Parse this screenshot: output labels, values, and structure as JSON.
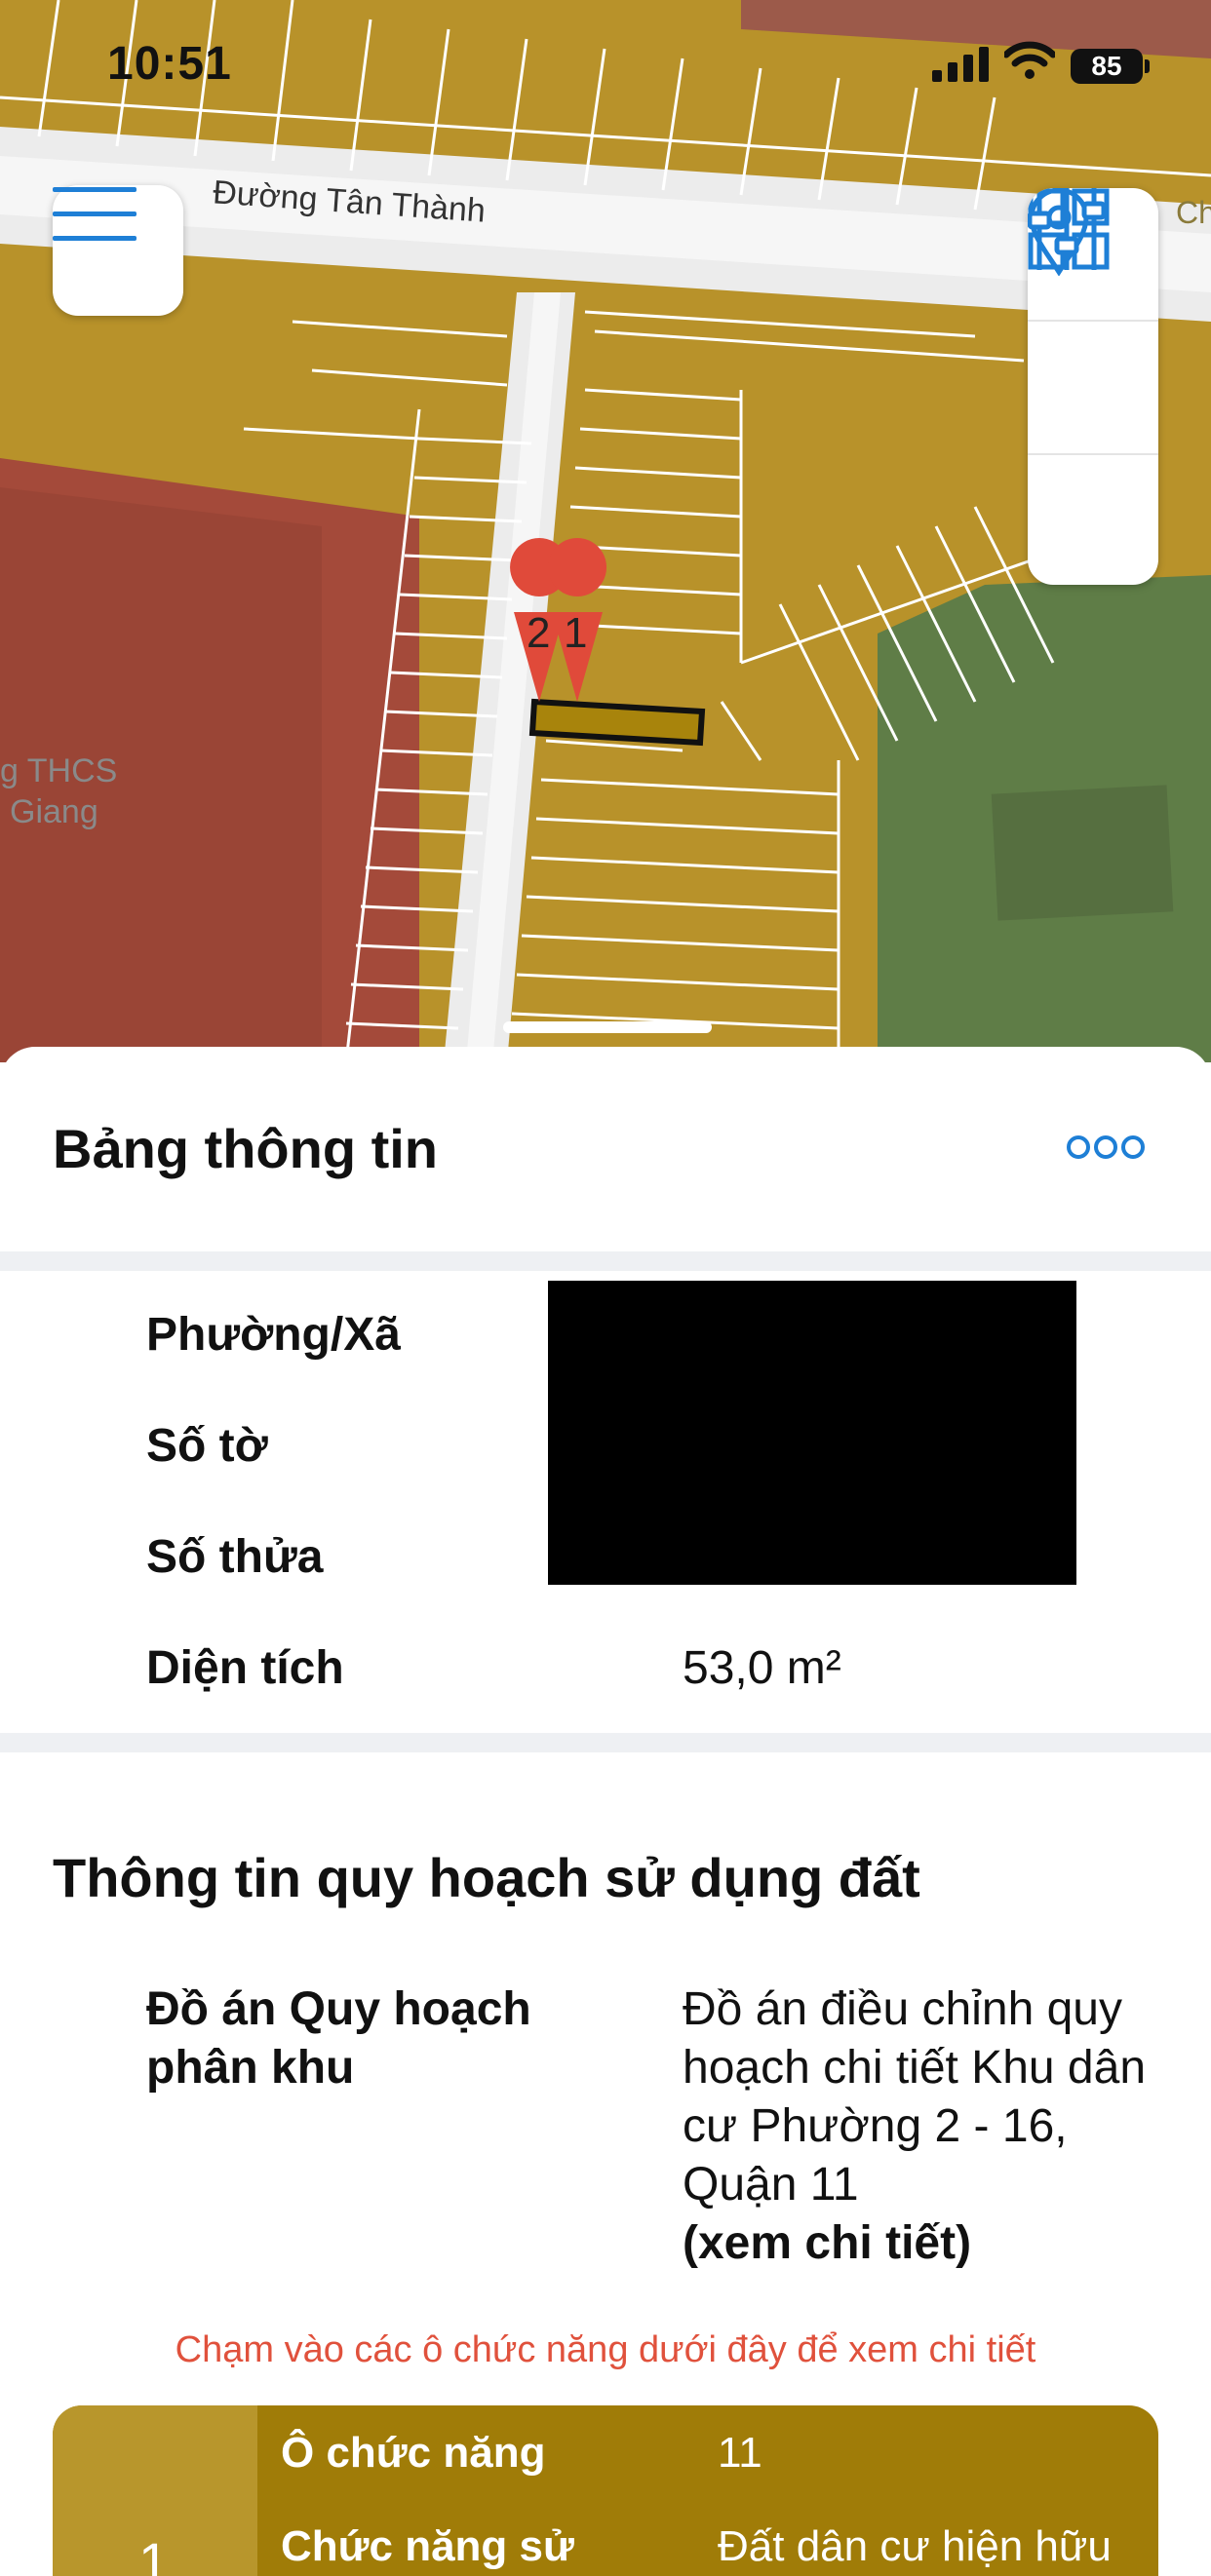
{
  "status_bar": {
    "time": "10:51",
    "battery": "85"
  },
  "map": {
    "street_label": "Đường Tân Thành",
    "poi_label_line1": "g THCS",
    "poi_label_line2": "Giang",
    "marker_1": "1",
    "marker_2": "2",
    "edge_label": "Ch"
  },
  "colors": {
    "accent": "#1e7fd6",
    "land_residential": "#b8922a",
    "land_school": "#a44a3a",
    "land_park": "#5f7d47",
    "plan_card": "#a07c08",
    "hint": "#e0513c"
  },
  "toolbar": {
    "menu_icon": "hamburger-icon",
    "grid_icon": "grid-icon",
    "location_icon": "location-pin-icon",
    "filter_icon": "sliders-icon"
  },
  "panel": {
    "title": "Bảng thông tin",
    "rows": [
      {
        "label": "Phường/Xã",
        "value": ""
      },
      {
        "label": "Số tờ",
        "value": ""
      },
      {
        "label": "Số thửa",
        "value": ""
      },
      {
        "label": "Diện tích",
        "value": "53,0 m²"
      }
    ],
    "section2_title": "Thông tin quy hoạch sử dụng đất",
    "plan_label": "Đồ án Quy hoạch phân khu",
    "plan_value": "Đồ án điều chỉnh quy hoạch chi tiết Khu dân cư Phường 2 - 16, Quận 11",
    "plan_link": "(xem chi tiết)",
    "hint": "Chạm vào các ô chức năng dưới đây để xem chi tiết",
    "function_card": {
      "index": "1",
      "row1_label": "Ô chức năng",
      "row1_value": "11",
      "row2_label": "Chức năng sử",
      "row2_value": "Đất dân cư hiện hữu"
    }
  }
}
